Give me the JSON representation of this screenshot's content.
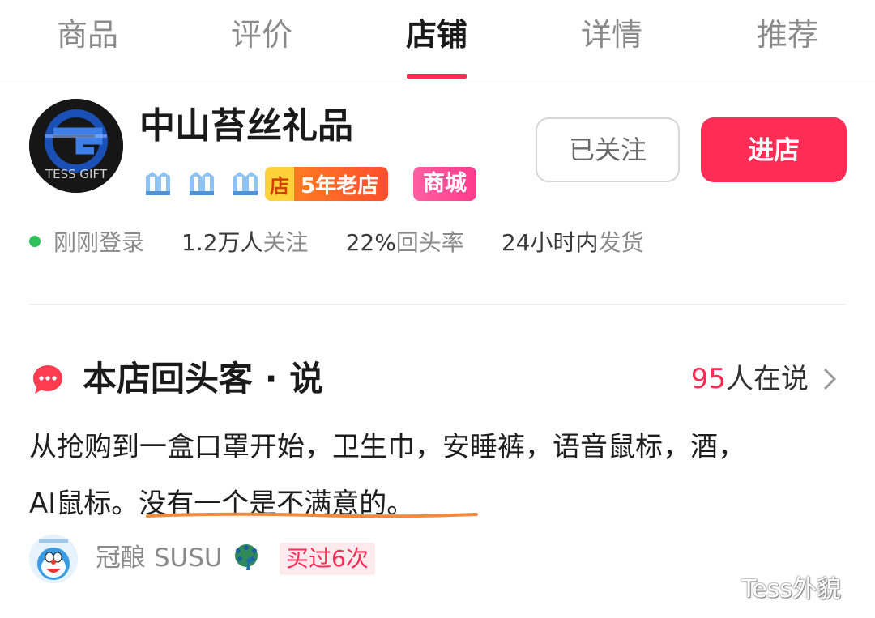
{
  "tabs": [
    {
      "label": "商品",
      "active": false
    },
    {
      "label": "评价",
      "active": false
    },
    {
      "label": "店铺",
      "active": true
    },
    {
      "label": "详情",
      "active": false
    },
    {
      "label": "推荐",
      "active": false
    }
  ],
  "shop": {
    "name": "中山苔丝礼品",
    "logo_text": "TESS GIFT",
    "level_icon": "crown-icon",
    "level_count": 3,
    "old_shop_mark": "店",
    "old_shop_label": "5年老店",
    "mall_label": "商城",
    "follow_label": "已关注",
    "enter_label": "进店",
    "status": "刚刚登录",
    "followers_num": "1.2万人",
    "followers_suffix": "关注",
    "return_rate_num": "22%",
    "return_rate_suffix": "回头率",
    "ship_prefix": "24小时内",
    "ship_suffix": "发货"
  },
  "returning_customers": {
    "title": "本店回头客 · 说",
    "count_num": "95",
    "count_suffix": "人在说",
    "review_line1": "从抢购到一盒口罩开始，卫生巾，安睡裤，语音鼠标，酒，",
    "review_line2": "AI鼠标。没有一个是不满意的。",
    "user_name": "冠酿 SUSU",
    "user_emoji_icon": "peacock-icon",
    "buy_badge": "买过6次"
  },
  "watermark": "Tess外貌",
  "colors": {
    "accent": "#ff2d55",
    "online": "#2ec05b",
    "old_shop_badge": "#ff6a26",
    "mall_badge": "#ff4d96",
    "annotation_underline": "#f08a3c"
  }
}
